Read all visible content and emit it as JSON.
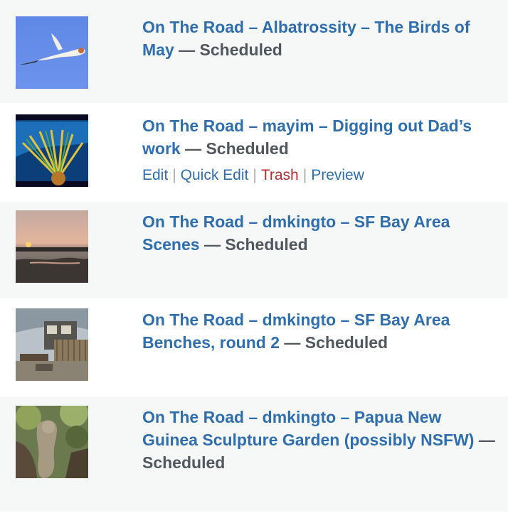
{
  "posts": [
    {
      "title": "On The Road – Albatrossity – The Birds of May",
      "separator": " — ",
      "state": "Scheduled",
      "thumbnail_icon": "bird-in-flight-photo"
    },
    {
      "title": "On The Road – mayim – Digging out Dad’s work",
      "separator": " — ",
      "state": "Scheduled",
      "thumbnail_icon": "abstract-fan-photo",
      "actions": {
        "edit": "Edit",
        "quick_edit": "Quick Edit",
        "trash": "Trash",
        "preview": "Preview",
        "divider": "|"
      }
    },
    {
      "title": "On The Road – dmkingto – SF Bay Area Scenes",
      "separator": " — ",
      "state": "Scheduled",
      "thumbnail_icon": "sunset-bay-photo"
    },
    {
      "title": "On The Road – dmkingto – SF Bay Area Benches, round 2",
      "separator": " — ",
      "state": "Scheduled",
      "thumbnail_icon": "bench-courtyard-photo"
    },
    {
      "title": "On The Road – dmkingto – Papua New Guinea Sculpture Garden (possibly NSFW)",
      "separator": " — ",
      "state": "Scheduled",
      "thumbnail_icon": "sculpture-garden-photo"
    }
  ],
  "colors": {
    "link": "#2f6fb0",
    "state": "#50575e",
    "trash": "#b32d2e",
    "row_alt": "#f6f7f7"
  }
}
